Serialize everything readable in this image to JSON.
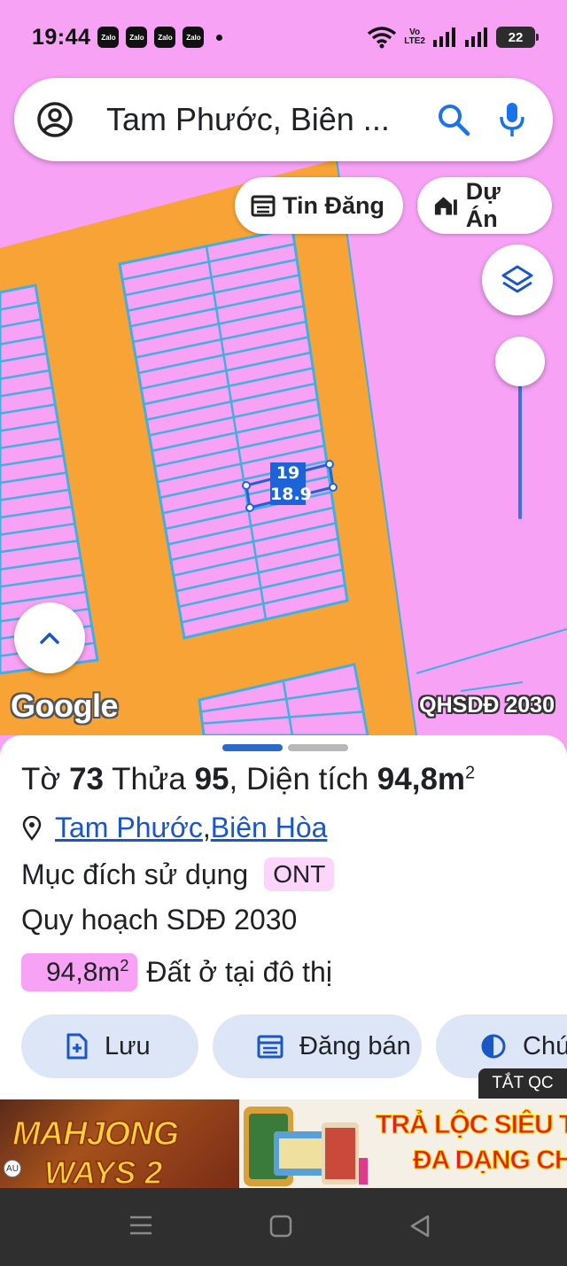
{
  "status_bar": {
    "time": "19:44",
    "notification_icons": [
      "Zalo",
      "Zalo",
      "Zalo",
      "Zalo"
    ],
    "volte": [
      "Vo",
      "LTE2"
    ],
    "battery_level": "22"
  },
  "search": {
    "query": "Tam Phước, Biên ..."
  },
  "chips": {
    "tin_dang": "Tin Đăng",
    "du_an": "Dự Án"
  },
  "map": {
    "plot_number": "19",
    "plot_width": "18.9",
    "google_logo": "Google",
    "watermark": "QHSDĐ 2030",
    "colors": {
      "residential": "#f7a2f5",
      "road": "#f7a335",
      "boundary": "#43aee0",
      "selected": "#1d63d8"
    },
    "zoom_level_fraction": 0.0
  },
  "sheet": {
    "title_prefix": "Tờ ",
    "sheet_no": "73",
    "title_mid": " Thửa ",
    "parcel_no": "95",
    "title_area_label": ", Diện tích ",
    "area": "94,8m",
    "area_sup": "2",
    "location_ward": "Tam Phước",
    "location_sep": ", ",
    "location_city": "Biên Hòa",
    "purpose_label": "Mục đích sử dụng",
    "purpose_code": "ONT",
    "planning_label": "Quy hoạch SDĐ 2030",
    "land_area": "94,8m",
    "land_area_sup": "2",
    "land_type": "Đất ở tại đô thị",
    "actions": {
      "save": "Lưu",
      "post": "Đăng bán",
      "legend": "Chú t"
    }
  },
  "ad": {
    "close_label": "TẮT QC",
    "game_line1": "MAHJONG",
    "game_line2": "WAYS 2",
    "promo_line1": "TRẢ LỘC SIÊU TỐC",
    "promo_line2": "ĐA DẠNG CHƠI",
    "badge": "AU"
  },
  "navbar": {
    "icons": [
      "menu-icon",
      "home-icon",
      "back-icon"
    ]
  }
}
